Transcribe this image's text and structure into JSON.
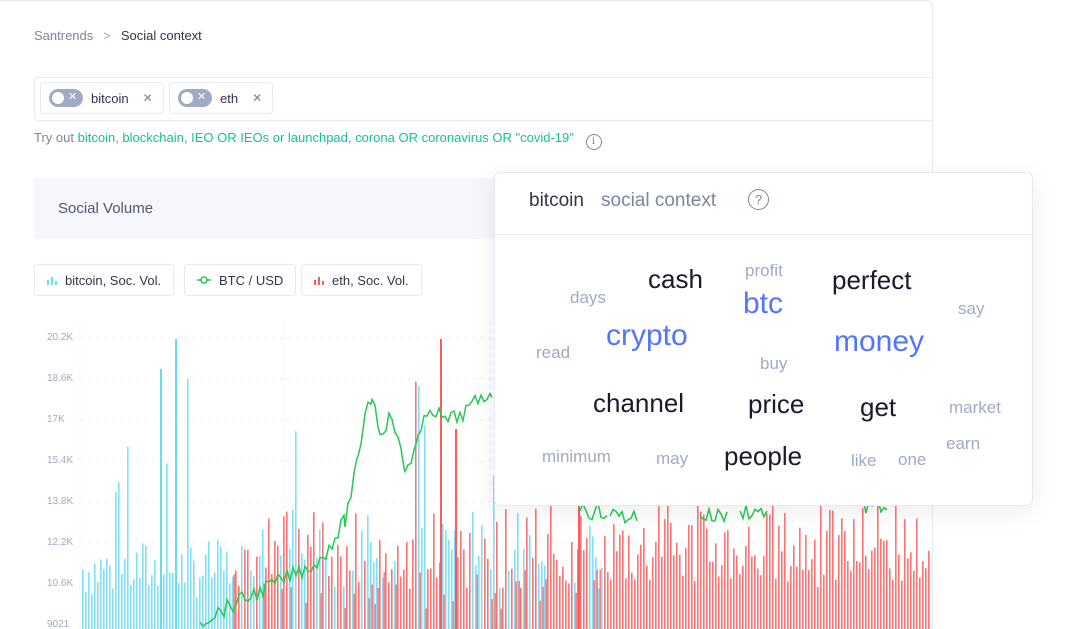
{
  "breadcrumb": {
    "root": "Santrends",
    "separator": ">",
    "current": "Social context"
  },
  "search": {
    "chips": [
      {
        "label": "bitcoin",
        "toggle_on": false
      },
      {
        "label": "eth",
        "toggle_on": false
      }
    ]
  },
  "tryout": {
    "prefix": "Try out",
    "links": [
      "bitcoin",
      "blockchain",
      "IEO OR IEOs or launchpad",
      "corona OR coronavirus OR \"covid-19\""
    ]
  },
  "volume": {
    "title": "Social Volume"
  },
  "legend": [
    {
      "label": "bitcoin, Soc. Vol.",
      "icon": "bar-icon",
      "color": "#68dbf4"
    },
    {
      "label": "BTC / USD",
      "icon": "line-icon",
      "color": "#26c953"
    },
    {
      "label": "eth, Soc. Vol.",
      "icon": "bar-icon",
      "color": "#ff5b5b"
    }
  ],
  "chart": {
    "y_ticks": [
      "20.2K",
      "18.6K",
      "17K",
      "15.4K",
      "13.8K",
      "12.2K",
      "10.6K",
      "9021"
    ]
  },
  "chart_data": {
    "type": "bar",
    "ylim": [
      9021,
      20200
    ],
    "series": [
      {
        "name": "bitcoin, Soc. Vol.",
        "type": "bar",
        "color": "#68dbf4"
      },
      {
        "name": "BTC / USD",
        "type": "line",
        "color": "#26c953"
      },
      {
        "name": "eth, Soc. Vol.",
        "type": "bar",
        "color": "#ff5b5b"
      }
    ]
  },
  "popup": {
    "word": "bitcoin",
    "title_rest": "social context",
    "help": "?",
    "words": [
      {
        "text": "cash",
        "size": "l",
        "color": "dark"
      },
      {
        "text": "profit",
        "size": "s",
        "color": "grey"
      },
      {
        "text": "perfect",
        "size": "l",
        "color": "dark"
      },
      {
        "text": "days",
        "size": "s",
        "color": "grey"
      },
      {
        "text": "btc",
        "size": "xl",
        "color": "blue"
      },
      {
        "text": "say",
        "size": "s",
        "color": "grey"
      },
      {
        "text": "crypto",
        "size": "xl",
        "color": "blue"
      },
      {
        "text": "money",
        "size": "xl",
        "color": "blue"
      },
      {
        "text": "read",
        "size": "s",
        "color": "grey"
      },
      {
        "text": "buy",
        "size": "s",
        "color": "grey"
      },
      {
        "text": "channel",
        "size": "l",
        "color": "dark"
      },
      {
        "text": "price",
        "size": "l",
        "color": "dark"
      },
      {
        "text": "get",
        "size": "l",
        "color": "dark"
      },
      {
        "text": "market",
        "size": "s",
        "color": "grey"
      },
      {
        "text": "earn",
        "size": "s",
        "color": "grey"
      },
      {
        "text": "minimum",
        "size": "s",
        "color": "grey"
      },
      {
        "text": "may",
        "size": "s",
        "color": "grey"
      },
      {
        "text": "people",
        "size": "l",
        "color": "dark"
      },
      {
        "text": "like",
        "size": "s",
        "color": "grey"
      },
      {
        "text": "one",
        "size": "s",
        "color": "grey"
      }
    ]
  }
}
